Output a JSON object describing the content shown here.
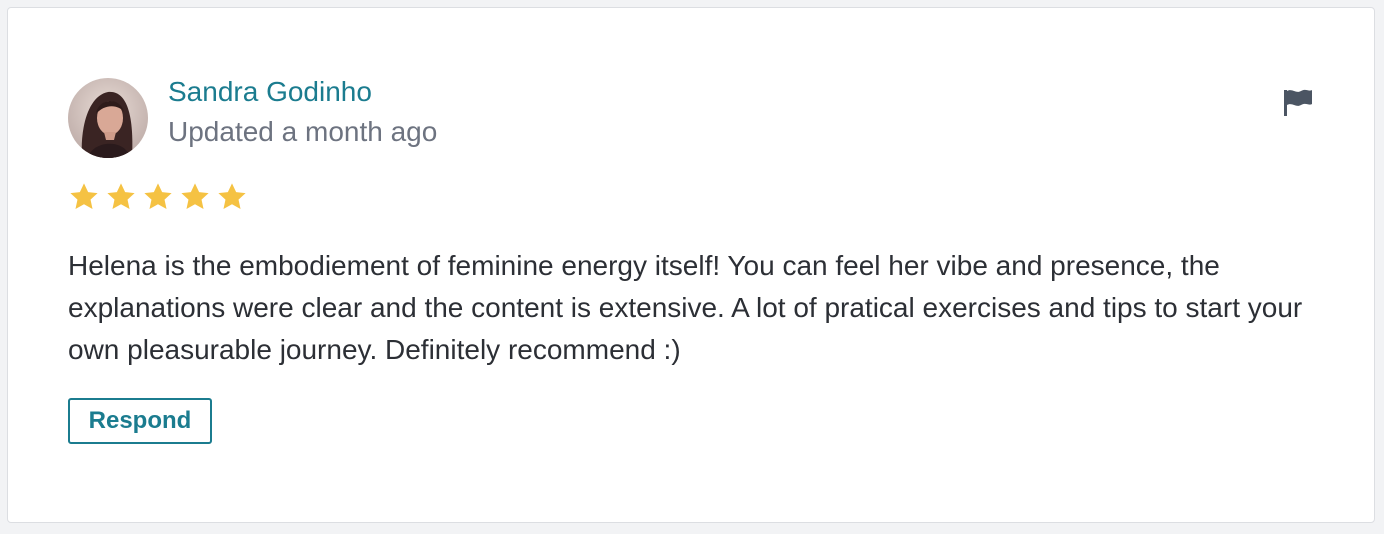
{
  "review": {
    "reviewer_name": "Sandra Godinho",
    "updated_text": "Updated a month ago",
    "rating": 5,
    "rating_max": 5,
    "text": "Helena is the embodiement of feminine energy itself! You can feel her vibe and presence, the explanations were clear and the content is extensive. A lot of pratical exercises and tips to start your own pleasurable journey. Definitely recommend :)",
    "respond_label": "Respond"
  },
  "icons": {
    "report": "flag-icon",
    "rating": "star-icon",
    "avatar": "user-photo"
  },
  "colors": {
    "accent": "#1b7c8f",
    "star": "#f5c243",
    "muted_text": "#6d7380",
    "body_text": "#2c2f35",
    "flag": "#4b5563"
  }
}
